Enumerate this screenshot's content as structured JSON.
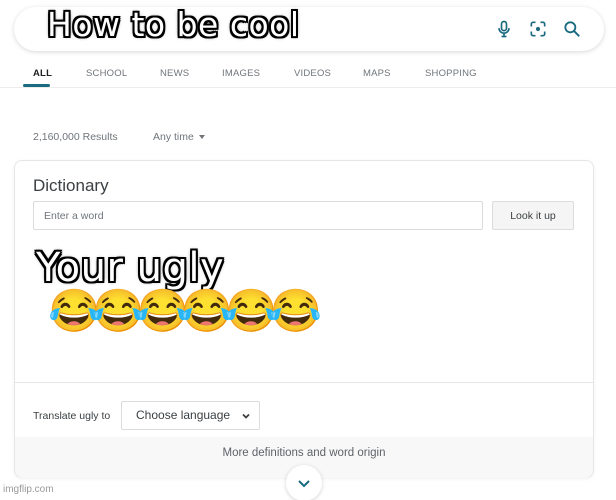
{
  "search": {
    "query_caption": "How to be cool",
    "icons": [
      "mic-icon",
      "lens-icon",
      "search-icon"
    ],
    "accent_color": "#1a6b80"
  },
  "tabs": [
    {
      "label": "ALL",
      "active": true
    },
    {
      "label": "SCHOOL",
      "active": false
    },
    {
      "label": "NEWS",
      "active": false
    },
    {
      "label": "IMAGES",
      "active": false
    },
    {
      "label": "VIDEOS",
      "active": false
    },
    {
      "label": "MAPS",
      "active": false
    },
    {
      "label": "SHOPPING",
      "active": false
    }
  ],
  "results": {
    "count": "2,160,000 Results",
    "time_filter": "Any time"
  },
  "dictionary": {
    "title": "Dictionary",
    "input_placeholder": "Enter a word",
    "input_value": "",
    "lookup_label": "Look it up",
    "translate_label": "Translate ugly to",
    "language_select": "Choose language",
    "more_label": "More definitions and word origin"
  },
  "meme": {
    "caption": "Your ugly",
    "emojis": "😂😂😂😂😂😂"
  },
  "watermark": "imgflip.com"
}
